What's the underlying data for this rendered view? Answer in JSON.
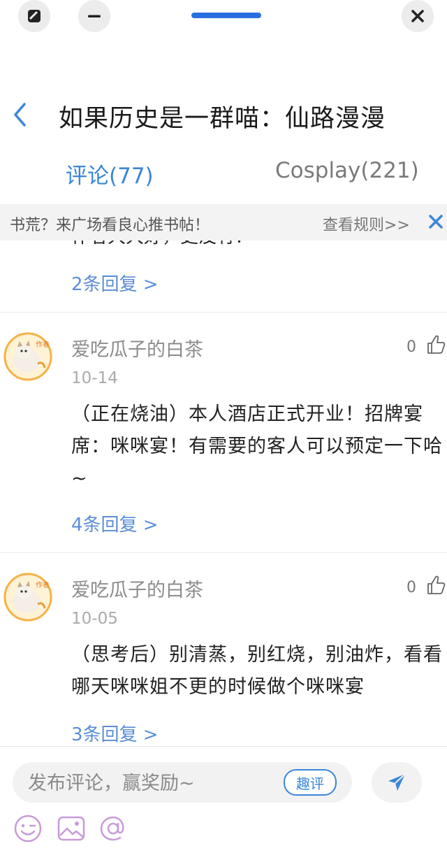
{
  "header": {
    "title": "如果历史是一群喵：仙路漫漫"
  },
  "tabs": [
    {
      "label": "评论(77)"
    },
    {
      "label": "Cosplay(221)"
    }
  ],
  "banner": {
    "text": "书荒？来广场看良心推书帖！",
    "rules_link": "查看规则>>"
  },
  "comments": {
    "partial": {
      "clipped_text": "作者大大好，更没有！",
      "replies": "2条回复 >"
    },
    "items": [
      {
        "user": "爱吃瓜子的白茶",
        "badge": "作者",
        "date": "10-14",
        "likes": "0",
        "text": "（正在烧油）本人酒店正式开业！招牌宴席：咪咪宴！有需要的客人可以预定一下哈 ~",
        "replies": "4条回复 >"
      },
      {
        "user": "爱吃瓜子的白茶",
        "badge": "作者",
        "date": "10-05",
        "likes": "0",
        "text": "（思考后）别清蒸，别红烧，别油炸，看看哪天咪咪姐不更的时候做个咪咪宴",
        "replies": "3条回复 >"
      }
    ]
  },
  "composer": {
    "placeholder": "发布评论，赢奖励~",
    "quping_label": "趣评"
  },
  "colors": {
    "accent": "#3a86d8",
    "reply_link": "#5b8ed6"
  }
}
